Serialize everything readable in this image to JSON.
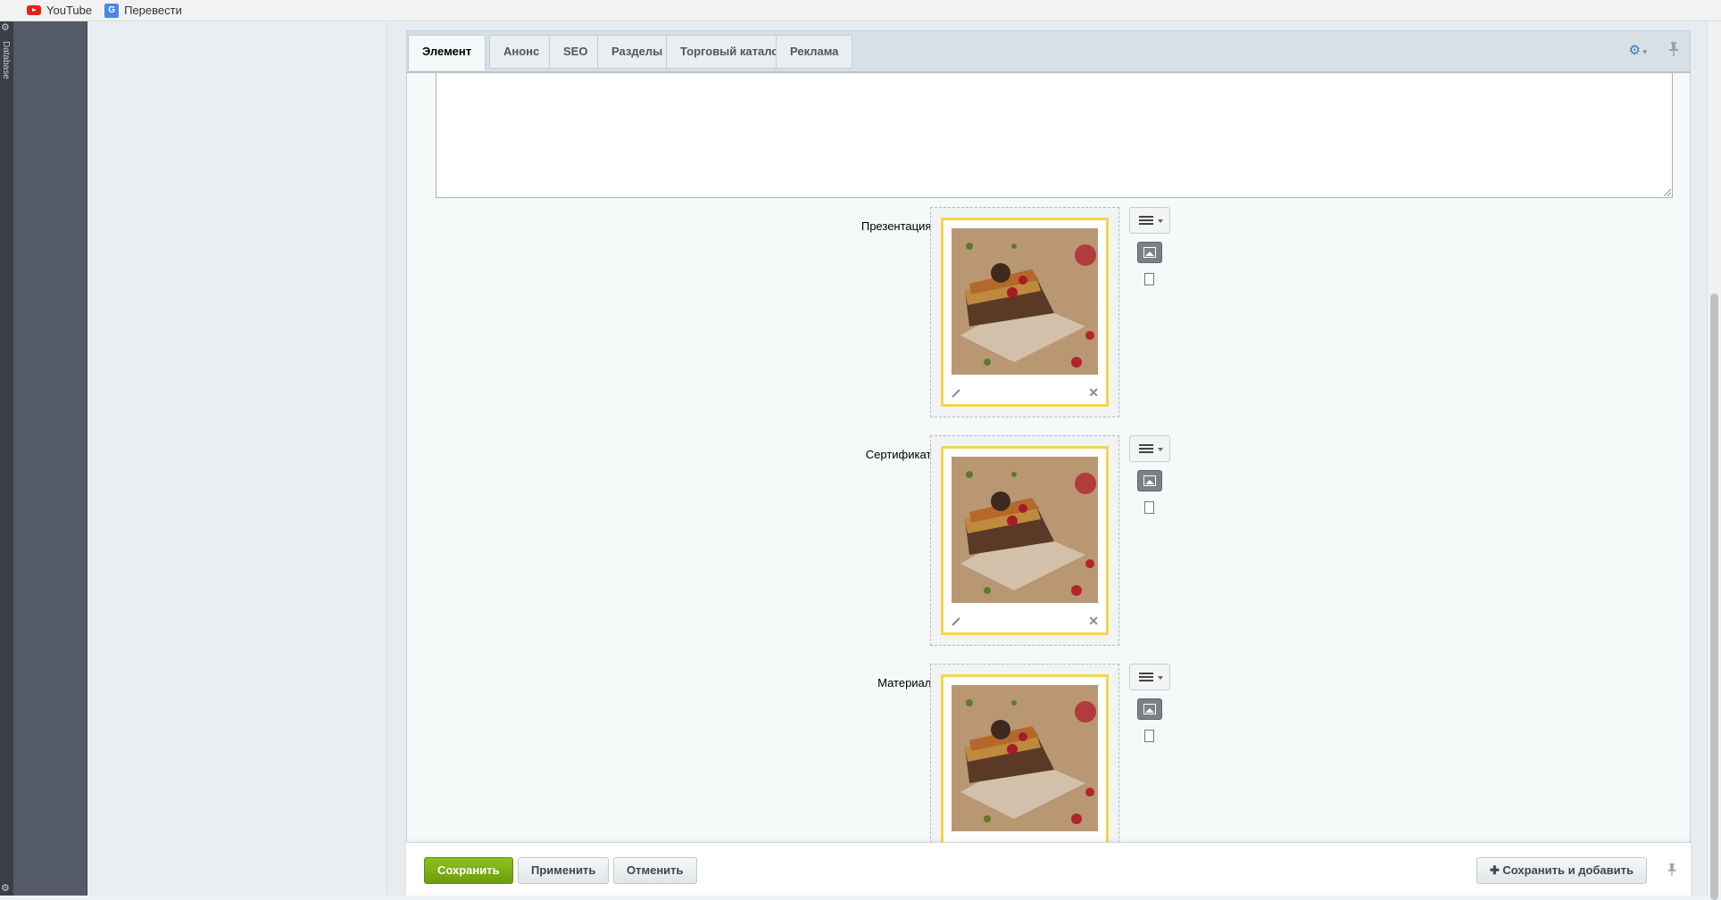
{
  "bookmarks": [
    {
      "label": "YouTube",
      "icon": "youtube-icon"
    },
    {
      "label": "Перевести",
      "icon": "translate-icon"
    }
  ],
  "sidebar_strip": {
    "label": "Database"
  },
  "tabs": [
    {
      "label": "Элемент",
      "active": true
    },
    {
      "label": "Анонс",
      "active": false
    },
    {
      "label": "SEO",
      "active": false
    },
    {
      "label": "Разделы",
      "active": false
    },
    {
      "label": "Торговый каталог",
      "active": false
    },
    {
      "label": "Реклама",
      "active": false
    }
  ],
  "fields": [
    {
      "label": "Презентация:",
      "has_image": true
    },
    {
      "label": "Сертификат:",
      "has_image": true
    },
    {
      "label": "Материал:",
      "has_image": true
    }
  ],
  "actions": {
    "save": "Сохранить",
    "apply": "Применить",
    "cancel": "Отменить",
    "save_add": "Сохранить и добавить"
  },
  "colors": {
    "accent_green": "#7cb30f",
    "image_frame": "#f5d64b",
    "tab_gear": "#2f7dcb"
  }
}
